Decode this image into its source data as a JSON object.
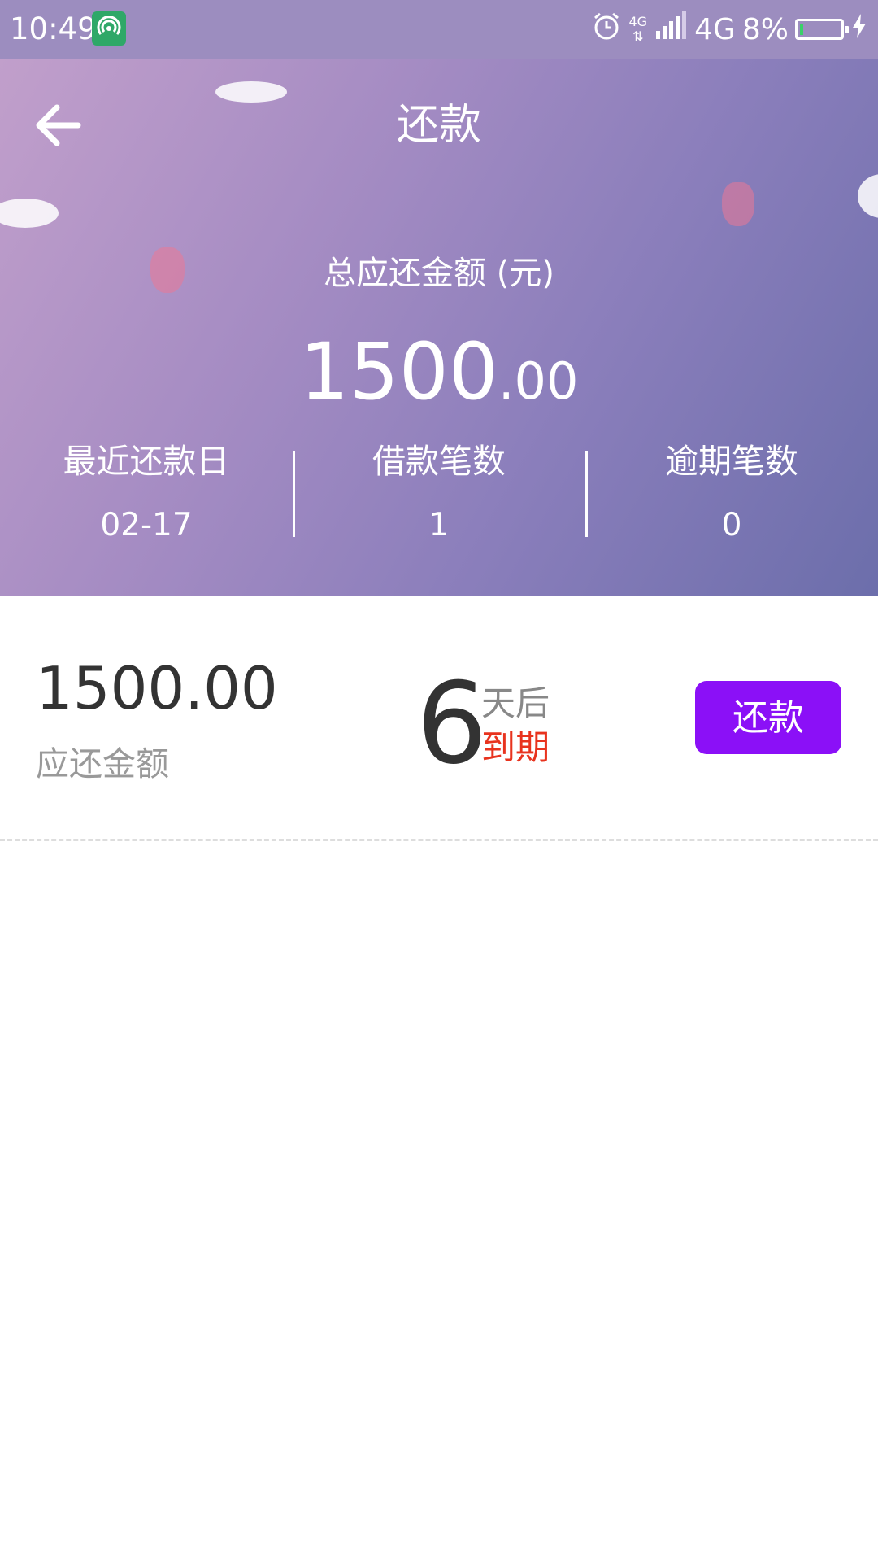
{
  "status_bar": {
    "time": "10:49",
    "network_small": "4G",
    "network": "4G",
    "battery": "8%",
    "battery_level": 0.08,
    "icons": [
      "app-signal-icon",
      "alarm-icon",
      "signal-bars-icon",
      "battery-icon",
      "charging-icon"
    ]
  },
  "header": {
    "title": "还款",
    "total_label": "总应还金额 (元)",
    "total_int": "1500",
    "total_dec": ".00",
    "stats": [
      {
        "label": "最近还款日",
        "value": "02-17"
      },
      {
        "label": "借款笔数",
        "value": "1"
      },
      {
        "label": "逾期笔数",
        "value": "0"
      }
    ]
  },
  "loan": {
    "amount": "1500.00",
    "amount_label": "应还金额",
    "days": "6",
    "days_suffix": "天后",
    "due_text": "到期",
    "repay_button": "还款"
  },
  "colors": {
    "accent": "#8b10f7",
    "due_red": "#e8331e",
    "status_bar": "#9c8dbf"
  }
}
